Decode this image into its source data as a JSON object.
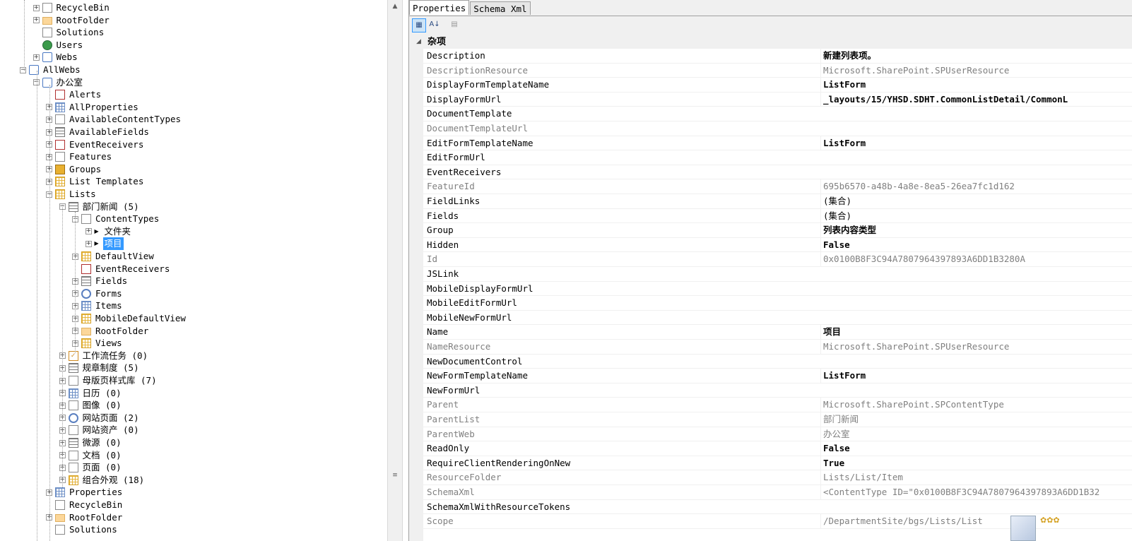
{
  "tree": [
    {
      "label": "RecycleBin",
      "depth": 2,
      "exp": "+",
      "icon": "doc"
    },
    {
      "label": "RootFolder",
      "depth": 2,
      "exp": "+",
      "icon": "folder"
    },
    {
      "label": "Solutions",
      "depth": 2,
      "exp": "",
      "icon": "doc"
    },
    {
      "label": "Users",
      "depth": 2,
      "exp": "",
      "icon": "user"
    },
    {
      "label": "Webs",
      "depth": 2,
      "exp": "+",
      "icon": "net"
    },
    {
      "label": "AllWebs",
      "depth": 1,
      "exp": "-",
      "icon": "net"
    },
    {
      "label": "办公室",
      "depth": 2,
      "exp": "-",
      "icon": "net"
    },
    {
      "label": "Alerts",
      "depth": 3,
      "exp": "",
      "icon": "red"
    },
    {
      "label": "AllProperties",
      "depth": 3,
      "exp": "+",
      "icon": "grid"
    },
    {
      "label": "AvailableContentTypes",
      "depth": 3,
      "exp": "+",
      "icon": "doc"
    },
    {
      "label": "AvailableFields",
      "depth": 3,
      "exp": "+",
      "icon": "list"
    },
    {
      "label": "EventReceivers",
      "depth": 3,
      "exp": "+",
      "icon": "red"
    },
    {
      "label": "Features",
      "depth": 3,
      "exp": "+",
      "icon": "doc"
    },
    {
      "label": "Groups",
      "depth": 3,
      "exp": "+",
      "icon": "grp"
    },
    {
      "label": "List Templates",
      "depth": 3,
      "exp": "+",
      "icon": "table"
    },
    {
      "label": "Lists",
      "depth": 3,
      "exp": "-",
      "icon": "table"
    },
    {
      "label": "部门新闻 (5)",
      "depth": 4,
      "exp": "-",
      "icon": "list"
    },
    {
      "label": "ContentTypes",
      "depth": 5,
      "exp": "-",
      "icon": "doc"
    },
    {
      "label": "文件夹",
      "depth": 6,
      "exp": "+",
      "icon": "tri"
    },
    {
      "label": "项目",
      "depth": 6,
      "exp": "+",
      "icon": "tri",
      "selected": true
    },
    {
      "label": "DefaultView",
      "depth": 5,
      "exp": "+",
      "icon": "table"
    },
    {
      "label": "EventReceivers",
      "depth": 5,
      "exp": "",
      "icon": "red"
    },
    {
      "label": "Fields",
      "depth": 5,
      "exp": "+",
      "icon": "list"
    },
    {
      "label": "Forms",
      "depth": 5,
      "exp": "+",
      "icon": "gear"
    },
    {
      "label": "Items",
      "depth": 5,
      "exp": "+",
      "icon": "grid"
    },
    {
      "label": "MobileDefaultView",
      "depth": 5,
      "exp": "+",
      "icon": "table"
    },
    {
      "label": "RootFolder",
      "depth": 5,
      "exp": "+",
      "icon": "folder"
    },
    {
      "label": "Views",
      "depth": 5,
      "exp": "+",
      "icon": "table"
    },
    {
      "label": "工作流任务 (0)",
      "depth": 4,
      "exp": "+",
      "icon": "check"
    },
    {
      "label": "规章制度 (5)",
      "depth": 4,
      "exp": "+",
      "icon": "list"
    },
    {
      "label": "母版页样式库 (7)",
      "depth": 4,
      "exp": "+",
      "icon": "doc"
    },
    {
      "label": "日历 (0)",
      "depth": 4,
      "exp": "+",
      "icon": "grid"
    },
    {
      "label": "图像 (0)",
      "depth": 4,
      "exp": "+",
      "icon": "doc"
    },
    {
      "label": "网站页面 (2)",
      "depth": 4,
      "exp": "+",
      "icon": "gear"
    },
    {
      "label": "网站资产 (0)",
      "depth": 4,
      "exp": "+",
      "icon": "doc"
    },
    {
      "label": "微源 (0)",
      "depth": 4,
      "exp": "+",
      "icon": "list"
    },
    {
      "label": "文档 (0)",
      "depth": 4,
      "exp": "+",
      "icon": "doc"
    },
    {
      "label": "页面 (0)",
      "depth": 4,
      "exp": "+",
      "icon": "doc"
    },
    {
      "label": "组合外观 (18)",
      "depth": 4,
      "exp": "+",
      "icon": "table"
    },
    {
      "label": "Properties",
      "depth": 3,
      "exp": "+",
      "icon": "grid"
    },
    {
      "label": "RecycleBin",
      "depth": 3,
      "exp": "",
      "icon": "doc"
    },
    {
      "label": "RootFolder",
      "depth": 3,
      "exp": "+",
      "icon": "folder"
    },
    {
      "label": "Solutions",
      "depth": 3,
      "exp": "",
      "icon": "doc"
    }
  ],
  "tabs": [
    {
      "label": "Properties",
      "active": true
    },
    {
      "label": "Schema Xml",
      "active": false
    }
  ],
  "category": "杂项",
  "properties": [
    {
      "name": "Description",
      "value": "新建列表项。",
      "ro": false,
      "bold": true
    },
    {
      "name": "DescriptionResource",
      "value": "Microsoft.SharePoint.SPUserResource",
      "ro": true,
      "bold": false
    },
    {
      "name": "DisplayFormTemplateName",
      "value": "ListForm",
      "ro": false,
      "bold": true
    },
    {
      "name": "DisplayFormUrl",
      "value": "_layouts/15/YHSD.SDHT.CommonListDetail/CommonL",
      "ro": false,
      "bold": true
    },
    {
      "name": "DocumentTemplate",
      "value": "",
      "ro": false,
      "bold": false
    },
    {
      "name": "DocumentTemplateUrl",
      "value": "",
      "ro": true,
      "bold": false
    },
    {
      "name": "EditFormTemplateName",
      "value": "ListForm",
      "ro": false,
      "bold": true
    },
    {
      "name": "EditFormUrl",
      "value": "",
      "ro": false,
      "bold": false
    },
    {
      "name": "EventReceivers",
      "value": "",
      "ro": false,
      "bold": false
    },
    {
      "name": "FeatureId",
      "value": "695b6570-a48b-4a8e-8ea5-26ea7fc1d162",
      "ro": true,
      "bold": false
    },
    {
      "name": "FieldLinks",
      "value": "(集合)",
      "ro": false,
      "bold": false
    },
    {
      "name": "Fields",
      "value": "(集合)",
      "ro": false,
      "bold": false
    },
    {
      "name": "Group",
      "value": "列表内容类型",
      "ro": false,
      "bold": true
    },
    {
      "name": "Hidden",
      "value": "False",
      "ro": false,
      "bold": true
    },
    {
      "name": "Id",
      "value": "0x0100B8F3C94A7807964397893A6DD1B3280A",
      "ro": true,
      "bold": false
    },
    {
      "name": "JSLink",
      "value": "",
      "ro": false,
      "bold": false
    },
    {
      "name": "MobileDisplayFormUrl",
      "value": "",
      "ro": false,
      "bold": false
    },
    {
      "name": "MobileEditFormUrl",
      "value": "",
      "ro": false,
      "bold": false
    },
    {
      "name": "MobileNewFormUrl",
      "value": "",
      "ro": false,
      "bold": false
    },
    {
      "name": "Name",
      "value": "项目",
      "ro": false,
      "bold": true
    },
    {
      "name": "NameResource",
      "value": "Microsoft.SharePoint.SPUserResource",
      "ro": true,
      "bold": false
    },
    {
      "name": "NewDocumentControl",
      "value": "",
      "ro": false,
      "bold": false
    },
    {
      "name": "NewFormTemplateName",
      "value": "ListForm",
      "ro": false,
      "bold": true
    },
    {
      "name": "NewFormUrl",
      "value": "",
      "ro": false,
      "bold": false
    },
    {
      "name": "Parent",
      "value": "Microsoft.SharePoint.SPContentType",
      "ro": true,
      "bold": false
    },
    {
      "name": "ParentList",
      "value": "部门新闻",
      "ro": true,
      "bold": false
    },
    {
      "name": "ParentWeb",
      "value": "办公室",
      "ro": true,
      "bold": false
    },
    {
      "name": "ReadOnly",
      "value": "False",
      "ro": false,
      "bold": true
    },
    {
      "name": "RequireClientRenderingOnNew",
      "value": "True",
      "ro": false,
      "bold": true
    },
    {
      "name": "ResourceFolder",
      "value": "Lists/List/Item",
      "ro": true,
      "bold": false
    },
    {
      "name": "SchemaXml",
      "value": "<ContentType ID=\"0x0100B8F3C94A7807964397893A6DD1B32",
      "ro": true,
      "bold": false
    },
    {
      "name": "SchemaXmlWithResourceTokens",
      "value": "",
      "ro": false,
      "bold": false
    },
    {
      "name": "Scope",
      "value": "/DepartmentSite/bgs/Lists/List",
      "ro": true,
      "bold": false
    }
  ],
  "icons": {
    "categorized": "categorized-view-icon",
    "alphabetical": "alphabetical-sort-icon",
    "property_pages": "property-pages-icon"
  }
}
